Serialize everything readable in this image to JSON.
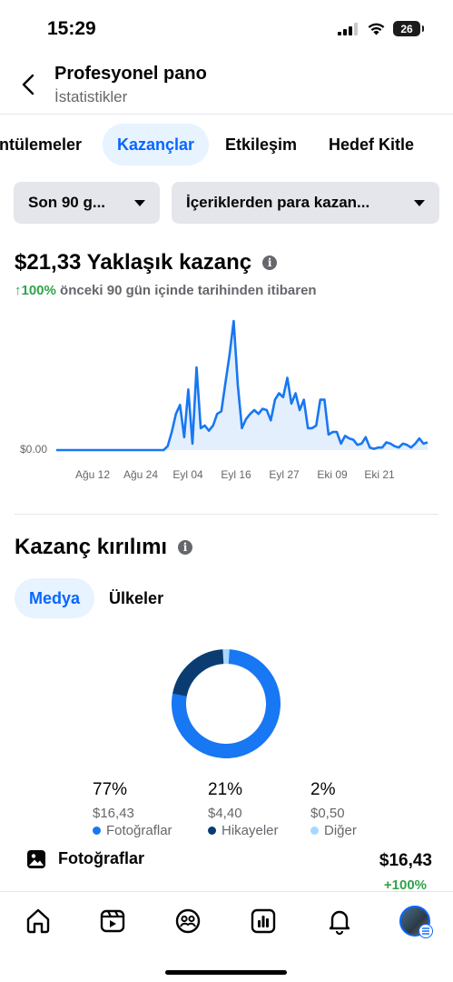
{
  "status_bar": {
    "time": "15:29",
    "battery": "26"
  },
  "header": {
    "title": "Profesyonel pano",
    "subtitle": "İstatistikler"
  },
  "tabs": [
    {
      "label": "ntülemeler",
      "active": false
    },
    {
      "label": "Kazançlar",
      "active": true
    },
    {
      "label": "Etkileşim",
      "active": false
    },
    {
      "label": "Hedef Kitle",
      "active": false
    }
  ],
  "filters": {
    "period": "Son 90 g...",
    "content": "İçeriklerden para kazan..."
  },
  "earnings": {
    "title": "$21,33 Yaklaşık kazanç",
    "change": "↑100%",
    "change_desc": " önceki 90 gün içinde tarihinden itibaren"
  },
  "chart_data": {
    "type": "area",
    "title": "",
    "xlabel": "",
    "ylabel": "",
    "x_ticks": [
      "Ağu 12",
      "Ağu 24",
      "Eyl 04",
      "Eyl 16",
      "Eyl 27",
      "Eki 09",
      "Eki 21"
    ],
    "y_ticks": [
      "$0.00"
    ],
    "color": "#1877f2",
    "fill": "#e3effd",
    "grid": false,
    "series": [
      {
        "values": [
          0,
          0,
          0,
          0,
          0,
          0,
          0,
          0,
          0,
          0,
          0,
          0,
          0,
          0,
          0,
          0,
          0,
          0,
          0,
          0,
          0,
          0,
          0,
          0,
          0,
          0,
          0,
          0.03,
          0.14,
          0.28,
          0.35,
          0.1,
          0.47,
          0.05,
          0.64,
          0.17,
          0.19,
          0.15,
          0.19,
          0.28,
          0.3,
          0.52,
          0.74,
          1.0,
          0.5,
          0.17,
          0.24,
          0.28,
          0.31,
          0.28,
          0.32,
          0.31,
          0.23,
          0.39,
          0.44,
          0.41,
          0.56,
          0.36,
          0.44,
          0.31,
          0.39,
          0.17,
          0.17,
          0.19,
          0.39,
          0.39,
          0.12,
          0.14,
          0.14,
          0.05,
          0.11,
          0.09,
          0.08,
          0.04,
          0.05,
          0.1,
          0.02,
          0.01,
          0.02,
          0.02,
          0.06,
          0.05,
          0.03,
          0.02,
          0.05,
          0.04,
          0.02,
          0.05,
          0.09,
          0.05,
          0.06
        ]
      }
    ]
  },
  "breakdown": {
    "title": "Kazanç kırılımı",
    "segments": [
      {
        "label": "Medya",
        "active": true
      },
      {
        "label": "Ülkeler",
        "active": false
      }
    ],
    "items": [
      {
        "pct": "77%",
        "value": "$16,43",
        "label": "Fotoğraflar",
        "color": "#1877f2",
        "fraction": 0.77
      },
      {
        "pct": "21%",
        "value": "$4,40",
        "label": "Hikayeler",
        "color": "#0a3c72",
        "fraction": 0.21
      },
      {
        "pct": "2%",
        "value": "$0,50",
        "label": "Diğer",
        "color": "#a8d8ff",
        "fraction": 0.02
      }
    ],
    "row": {
      "label": "Fotoğraflar",
      "value": "$16,43",
      "change": "+100%"
    }
  },
  "bottom_nav": [
    "home-icon",
    "reels-icon",
    "friends-icon",
    "dashboard-icon",
    "notifications-icon",
    "profile-avatar"
  ]
}
